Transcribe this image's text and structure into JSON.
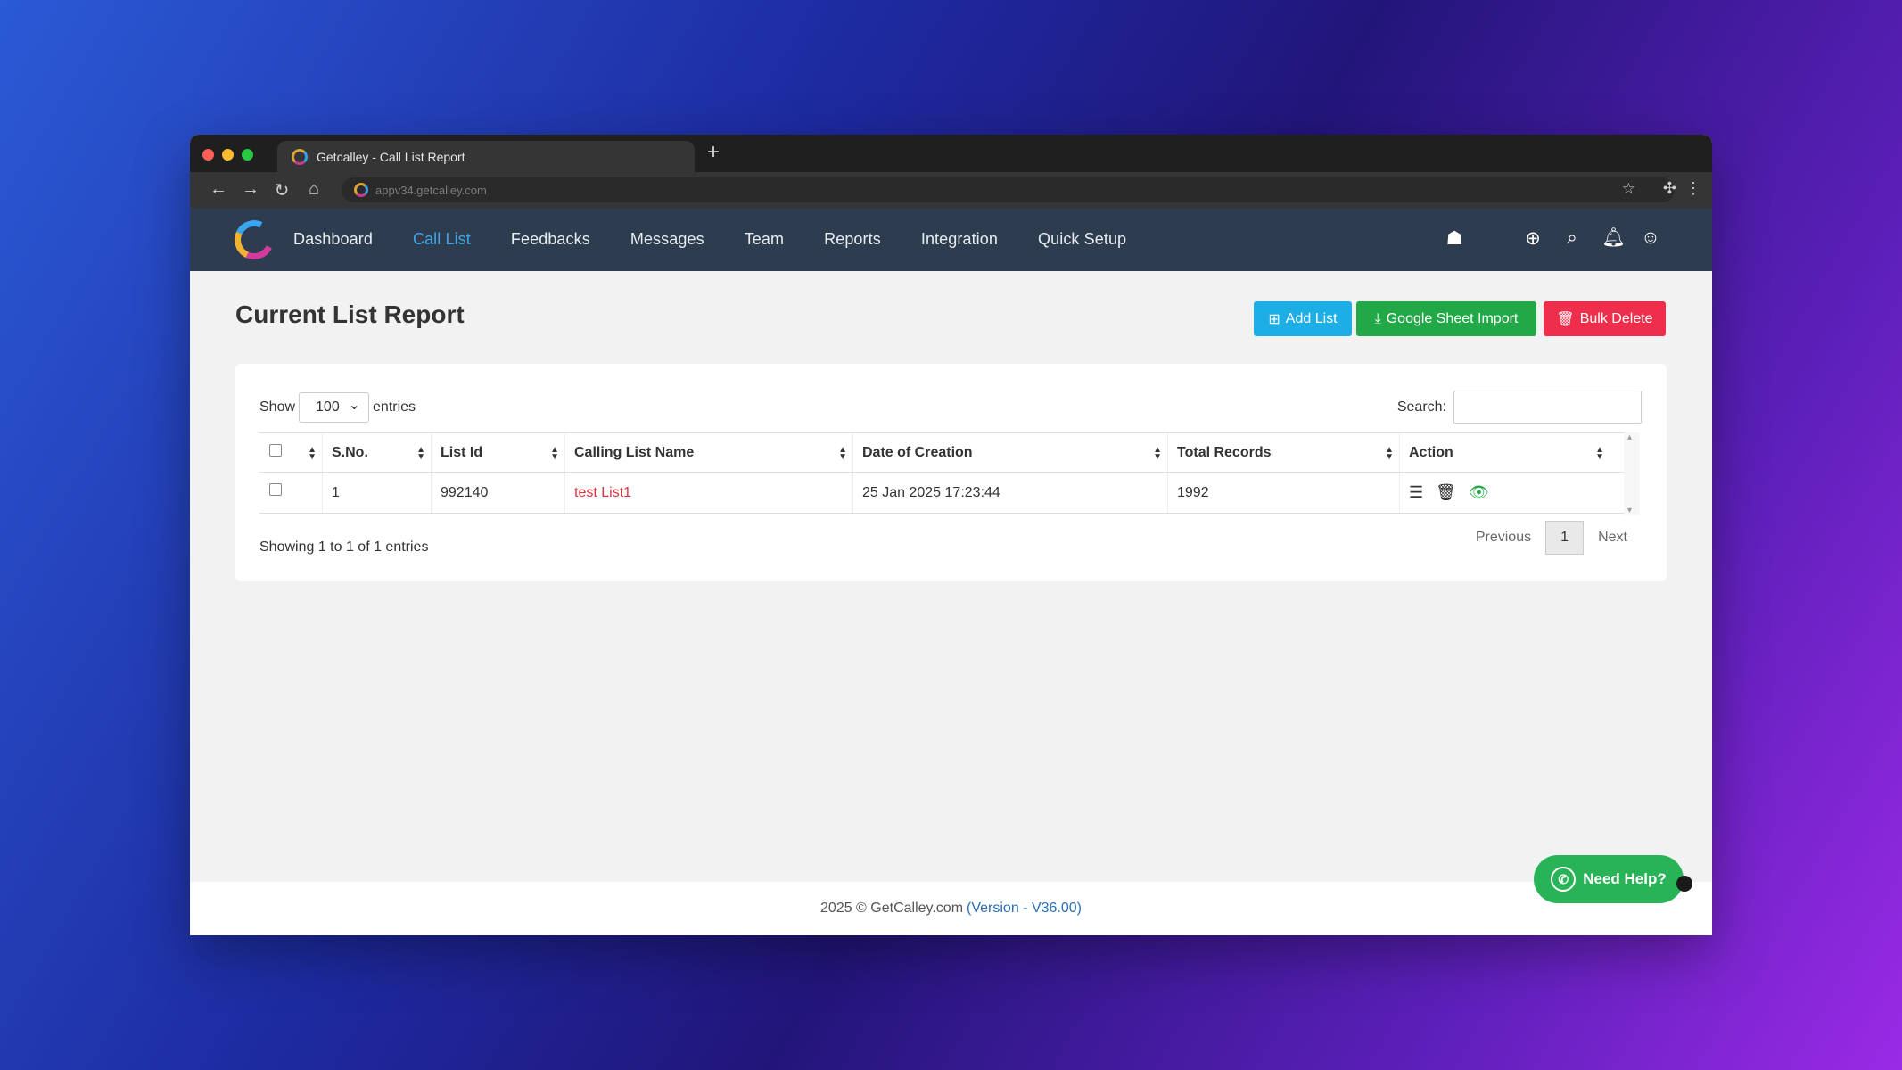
{
  "browser": {
    "tab_title": "Getcalley - Call List Report",
    "url": "appv34.getcalley.com"
  },
  "nav": {
    "items": [
      {
        "label": "Dashboard",
        "active": false
      },
      {
        "label": "Call List",
        "active": true
      },
      {
        "label": "Feedbacks",
        "active": false
      },
      {
        "label": "Messages",
        "active": false
      },
      {
        "label": "Team",
        "active": false
      },
      {
        "label": "Reports",
        "active": false
      },
      {
        "label": "Integration",
        "active": false
      },
      {
        "label": "Quick Setup",
        "active": false
      }
    ],
    "icons": [
      "android-icon",
      "apple-icon",
      "help-lifebuoy-icon",
      "search-icon",
      "bell-icon",
      "user-icon"
    ]
  },
  "page": {
    "title": "Current List Report",
    "buttons": {
      "add_list": "Add List",
      "google_sheet_import": "Google Sheet Import",
      "bulk_delete": "Bulk Delete"
    }
  },
  "table": {
    "show_label": "Show",
    "entries_label": "entries",
    "page_size": "100",
    "search_label": "Search:",
    "search_value": "",
    "columns": [
      "S.No.",
      "List Id",
      "Calling List Name",
      "Date of Creation",
      "Total Records",
      "Action"
    ],
    "rows": [
      {
        "sno": "1",
        "list_id": "992140",
        "name": "test List1",
        "created": "25 Jan 2025 17:23:44",
        "total": "1992"
      }
    ],
    "info": "Showing 1 to 1 of 1 entries",
    "pager": {
      "previous": "Previous",
      "page": "1",
      "next": "Next"
    }
  },
  "footer": {
    "text": "2025 © GetCalley.com",
    "version": "(Version - V36.00)"
  },
  "help_button": "Need Help?",
  "colors": {
    "nav_bg": "#2d3c4e",
    "active_nav": "#3fa7e6",
    "add_btn": "#1eaee6",
    "gs_btn": "#23a847",
    "delete_btn": "#ef2e4c",
    "list_name": "#e0303c"
  }
}
